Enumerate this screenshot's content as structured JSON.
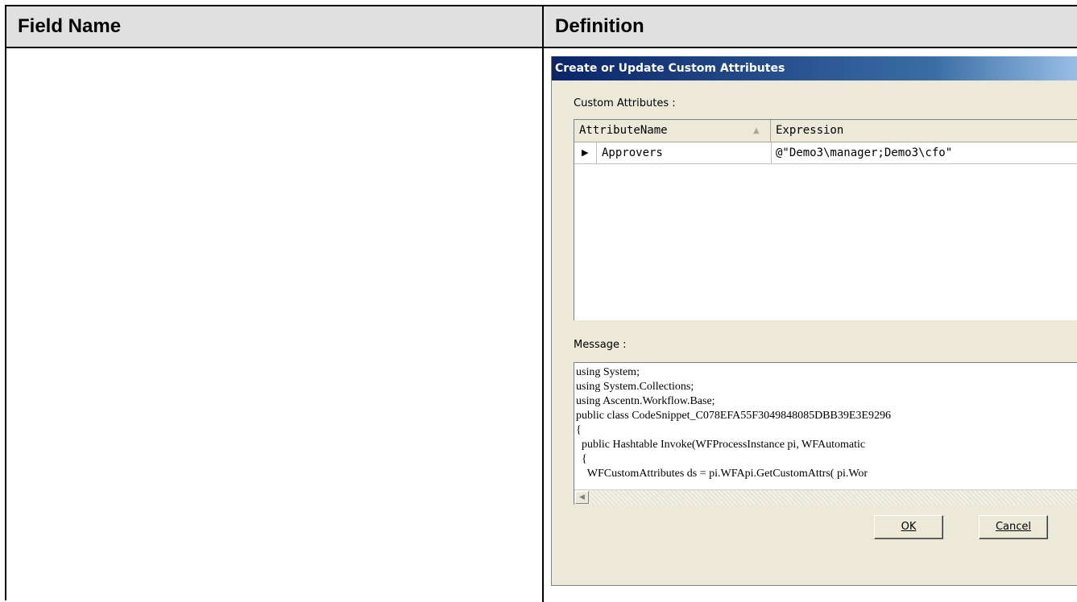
{
  "table": {
    "headers": {
      "field_name": "Field Name",
      "definition": "Definition"
    }
  },
  "dialog": {
    "title": "Create or Update Custom Attributes",
    "custom_attributes_label": "Custom Attributes :",
    "columns": {
      "name": "AttributeName",
      "expression": "Expression"
    },
    "sort_icon": "sort-ascending-icon",
    "rows": [
      {
        "indicator": "▶",
        "name": "Approvers",
        "expression": "@\"Demo3\\manager;Demo3\\cfo\""
      }
    ],
    "message_label": "Message :",
    "message_text": "using System;\nusing System.Collections;\nusing Ascentn.Workflow.Base;\npublic class CodeSnippet_C078EFA55F3049848085DBB39E3E9296\n{\n  public Hashtable Invoke(WFProcessInstance pi, WFAutomatic\n  {\n    WFCustomAttributes ds = pi.WFApi.GetCustomAttrs( pi.Wor",
    "buttons": {
      "ok": "OK",
      "cancel": "Cancel"
    }
  }
}
